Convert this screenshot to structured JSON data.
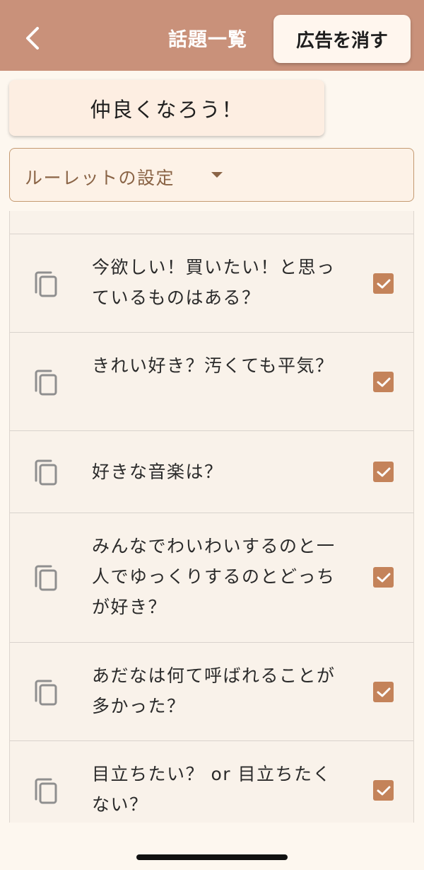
{
  "header": {
    "title": "話題一覧",
    "remove_ads_label": "広告を消す"
  },
  "category_label": "仲良くなろう！",
  "roulette": {
    "label": "ルーレットの設定"
  },
  "topics": [
    {
      "text": "今欲しい！買いたい！と思っているものはある？",
      "checked": true
    },
    {
      "text": "きれい好き？汚くても平気？",
      "checked": true
    },
    {
      "text": "好きな音楽は？",
      "checked": true
    },
    {
      "text": "みんなでわいわいするのと一人でゆっくりするのとどっちが好き？",
      "checked": true
    },
    {
      "text": "あだなは何て呼ばれることが多かった？",
      "checked": true
    },
    {
      "text": "目立ちたい？ or 目立ちたくない？",
      "checked": true
    }
  ],
  "icons": {
    "back": "chevron-left-icon",
    "copy": "copy-icon",
    "check": "checkmark-icon",
    "dropdown": "caret-down-icon"
  },
  "colors": {
    "header": "#c9917a",
    "checkbox": "#c4835a",
    "background": "#fdf7ef"
  }
}
